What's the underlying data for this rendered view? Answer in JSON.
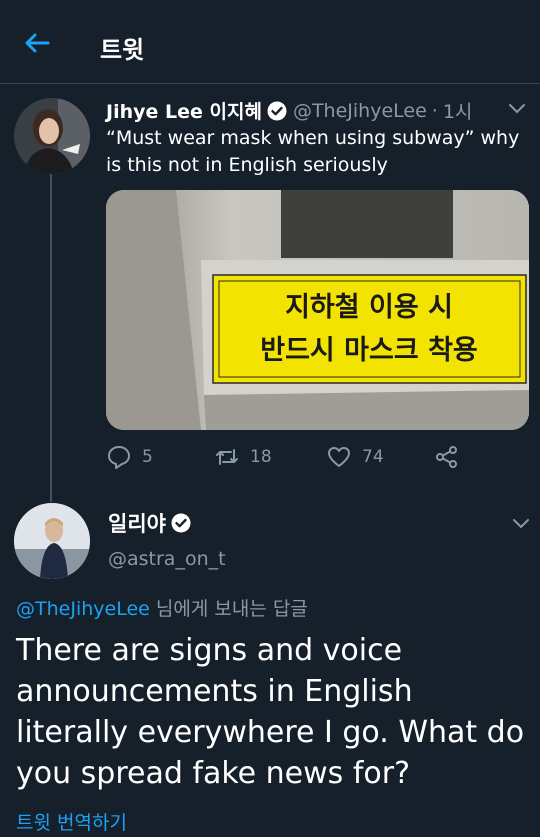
{
  "header": {
    "title": "트윗",
    "back_icon": "arrow-left-icon"
  },
  "tweet": {
    "author_name": "Jihye Lee 이지혜",
    "handle": "@TheJihyeLee",
    "separator": "·",
    "time": "1시",
    "text": "“Must wear mask when using subway” why is this not in English seriously",
    "image_sign_line1": "지하철 이용 시",
    "image_sign_line2": "반드시 마스크 착용",
    "replies": "5",
    "retweets": "18",
    "likes": "74"
  },
  "reply": {
    "author_name": "일리야",
    "handle": "@astra_on_t",
    "reply_to_mention": "@TheJihyeLee",
    "reply_to_suffix": " 님에게 보내는 답글",
    "text": "There are signs and voice announcements in English literally everywhere I go. What do you spread fake news for?",
    "translate_label": "트윗 번역하기"
  },
  "colors": {
    "background": "#15202b",
    "accent": "#1da1f2",
    "secondary_text": "#8899a6",
    "sign_yellow": "#f2e400"
  }
}
